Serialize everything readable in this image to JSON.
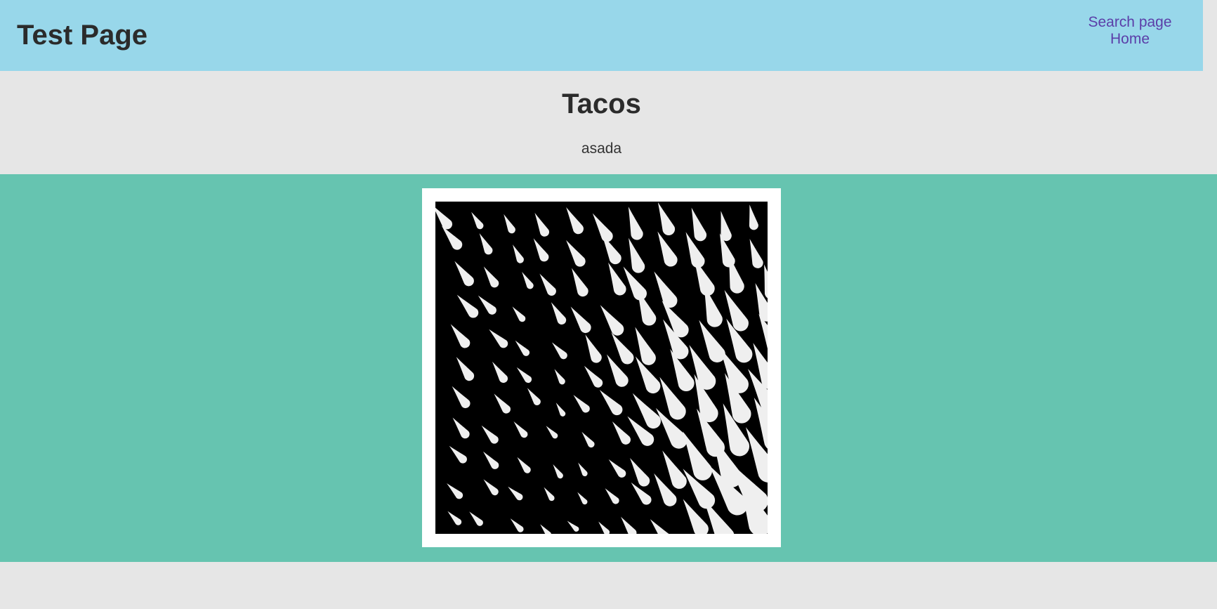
{
  "header": {
    "site_title": "Test Page",
    "nav": [
      {
        "label": "Search page"
      },
      {
        "label": "Home"
      }
    ]
  },
  "main": {
    "heading": "Tacos",
    "subtitle": "asada"
  },
  "colors": {
    "header_bg": "#98d7ea",
    "page_bg": "#e6e6e6",
    "gallery_bg": "#66c4b0",
    "link": "#5b3ea8",
    "artwork_bg": "#000000",
    "artwork_shapes": "#efefef"
  },
  "artwork": {
    "description_icon": "abstract-teardrop-pattern-image"
  }
}
